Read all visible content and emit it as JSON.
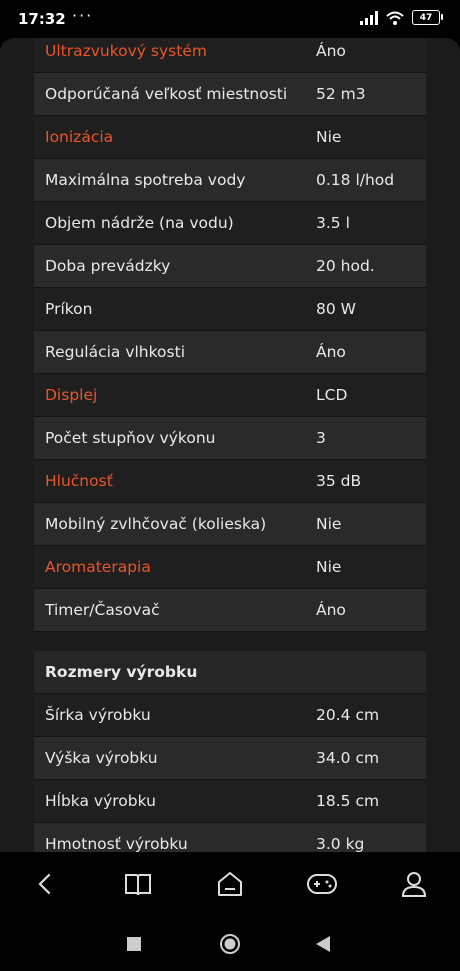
{
  "status": {
    "time": "17:32",
    "dots": "···",
    "battery": "47"
  },
  "specs": [
    {
      "label": "Ultrazvukový systém",
      "value": "Áno",
      "highlight": true
    },
    {
      "label": "Odporúčaná veľkosť miestnosti",
      "value": "52 m3",
      "highlight": false
    },
    {
      "label": "Ionizácia",
      "value": "Nie",
      "highlight": true
    },
    {
      "label": "Maximálna spotreba vody",
      "value": "0.18 l/hod",
      "highlight": false
    },
    {
      "label": "Objem nádrže (na vodu)",
      "value": "3.5 l",
      "highlight": false
    },
    {
      "label": "Doba prevádzky",
      "value": "20 hod.",
      "highlight": false
    },
    {
      "label": "Príkon",
      "value": "80 W",
      "highlight": false
    },
    {
      "label": "Regulácia vlhkosti",
      "value": "Áno",
      "highlight": false
    },
    {
      "label": "Displej",
      "value": "LCD",
      "highlight": true
    },
    {
      "label": "Počet stupňov výkonu",
      "value": "3",
      "highlight": false
    },
    {
      "label": "Hlučnosť",
      "value": "35 dB",
      "highlight": true
    },
    {
      "label": "Mobilný zvlhčovač (kolieska)",
      "value": "Nie",
      "highlight": false
    },
    {
      "label": "Aromaterapia",
      "value": "Nie",
      "highlight": true
    },
    {
      "label": "Timer/Časovač",
      "value": "Áno",
      "highlight": false
    }
  ],
  "dimensions": {
    "title": "Rozmery výrobku",
    "rows": [
      {
        "label": "Šírka výrobku",
        "value": "20.4 cm"
      },
      {
        "label": "Výška výrobku",
        "value": "34.0 cm"
      },
      {
        "label": "Hĺbka výrobku",
        "value": "18.5 cm"
      },
      {
        "label": "Hmotnosť výrobku",
        "value": "3.0 kg"
      }
    ]
  },
  "bottom_nav": [
    "back-icon",
    "book-icon",
    "home-icon",
    "gamepad-icon",
    "profile-icon"
  ],
  "system_nav": [
    "recents-icon",
    "home-circle-icon",
    "back-triangle-icon"
  ],
  "colors": {
    "accent": "#e8552b",
    "background": "#1b1b1b",
    "row_alt": "#2a2a2a"
  }
}
